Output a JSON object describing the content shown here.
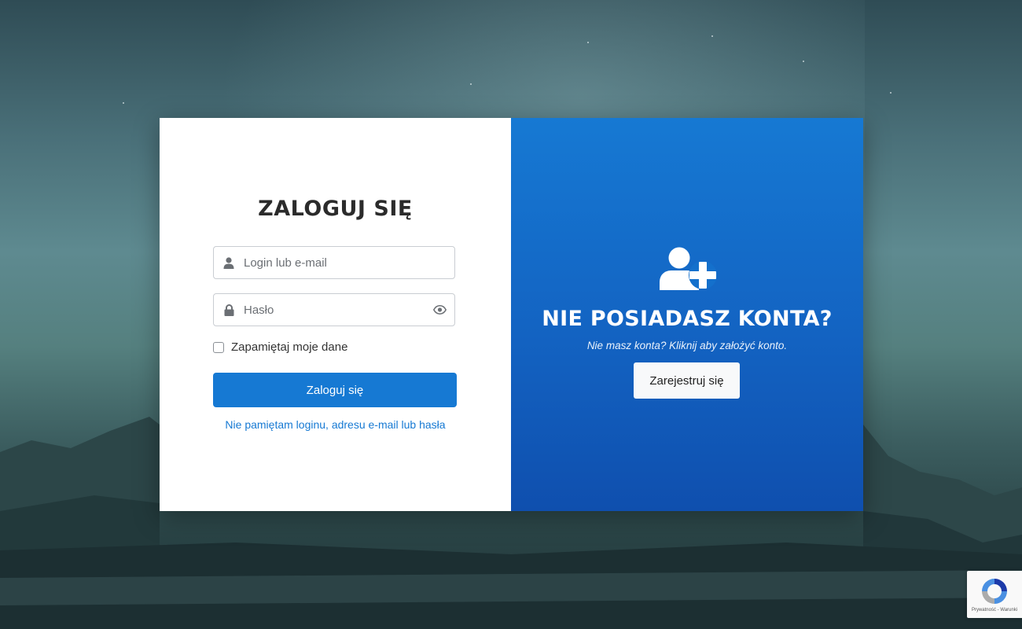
{
  "login": {
    "title": "ZALOGUJ SIĘ",
    "login_placeholder": "Login lub e-mail",
    "password_placeholder": "Hasło",
    "remember_label": "Zapamiętaj moje dane",
    "submit_label": "Zaloguj się",
    "forgot_link": "Nie pamiętam loginu, adresu e-mail lub hasła"
  },
  "signup": {
    "title": "NIE POSIADASZ KONTA?",
    "subtitle": "Nie masz konta? Kliknij aby założyć konto.",
    "register_label": "Zarejestruj się"
  },
  "recaptcha": {
    "terms_text": "Prywatność - Warunki"
  },
  "colors": {
    "accent": "#1679d3",
    "signup_gradient_top": "#1679d3",
    "signup_gradient_bottom": "#0f4fae"
  },
  "icons": {
    "login_field": "user-icon",
    "password_field": "lock-icon",
    "password_toggle": "eye-icon",
    "signup_header": "user-plus-icon",
    "recaptcha": "recaptcha-logo"
  }
}
